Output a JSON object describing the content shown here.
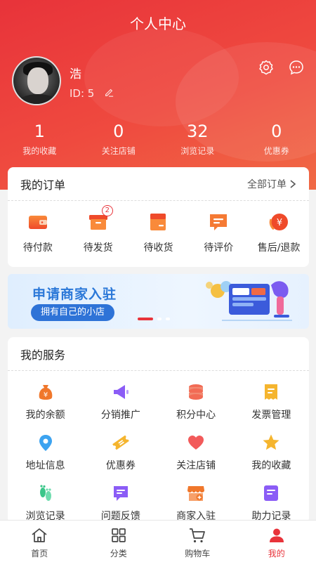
{
  "header": {
    "title": "个人中心"
  },
  "user": {
    "name": "浩",
    "id_text": "ID:  5"
  },
  "stats": [
    {
      "value": "1",
      "label": "我的收藏"
    },
    {
      "value": "0",
      "label": "关注店铺"
    },
    {
      "value": "32",
      "label": "浏览记录"
    },
    {
      "value": "0",
      "label": "优惠券"
    }
  ],
  "orders": {
    "title": "我的订单",
    "all_label": "全部订单",
    "items": [
      {
        "label": "待付款",
        "icon": "wallet-icon"
      },
      {
        "label": "待发货",
        "icon": "package-icon",
        "badge": "2"
      },
      {
        "label": "待收货",
        "icon": "box-icon"
      },
      {
        "label": "待评价",
        "icon": "comment-icon"
      },
      {
        "label": "售后/退款",
        "icon": "refund-icon"
      }
    ]
  },
  "banner": {
    "title": "申请商家入驻",
    "button": "拥有自己的小店"
  },
  "services": {
    "title": "我的服务",
    "items": [
      {
        "label": "我的余额",
        "icon": "money-bag-icon",
        "color": "#f0772b"
      },
      {
        "label": "分销推广",
        "icon": "megaphone-icon",
        "color": "#8b5cf6"
      },
      {
        "label": "积分中心",
        "icon": "coin-stack-icon",
        "color": "#f26b55"
      },
      {
        "label": "发票管理",
        "icon": "invoice-icon",
        "color": "#f5b52e"
      },
      {
        "label": "地址信息",
        "icon": "location-pin-icon",
        "color": "#3ca3f0"
      },
      {
        "label": "优惠券",
        "icon": "coupon-icon",
        "color": "#f5b52e"
      },
      {
        "label": "关注店铺",
        "icon": "heart-icon",
        "color": "#f25a5a"
      },
      {
        "label": "我的收藏",
        "icon": "star-icon",
        "color": "#f5b52e"
      },
      {
        "label": "浏览记录",
        "icon": "footprint-icon",
        "color": "#3cc68a"
      },
      {
        "label": "问题反馈",
        "icon": "feedback-icon",
        "color": "#8b5cf6"
      },
      {
        "label": "商家入驻",
        "icon": "shop-icon",
        "color": "#f0772b"
      },
      {
        "label": "助力记录",
        "icon": "record-icon",
        "color": "#8b5cf6"
      }
    ]
  },
  "tabbar": [
    {
      "label": "首页",
      "icon": "home-icon"
    },
    {
      "label": "分类",
      "icon": "category-icon"
    },
    {
      "label": "购物车",
      "icon": "cart-icon"
    },
    {
      "label": "我的",
      "icon": "user-icon",
      "active": true
    }
  ],
  "colors": {
    "brand": "#e8333a",
    "banner_blue": "#2b78d8"
  }
}
